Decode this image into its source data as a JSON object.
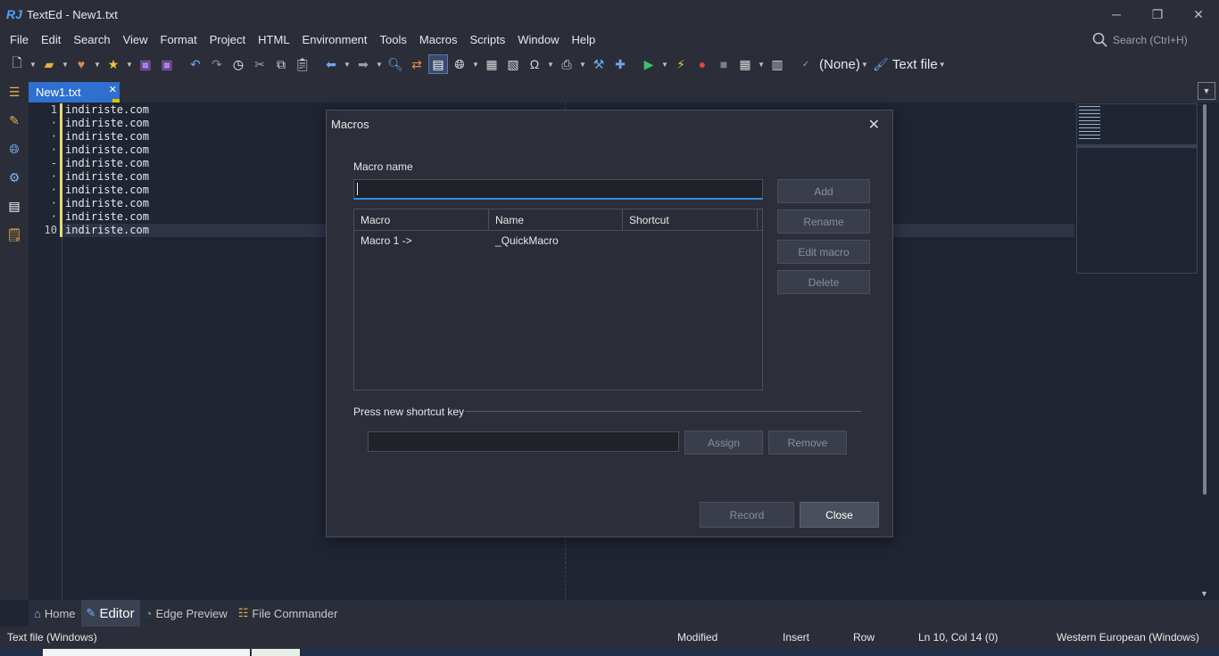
{
  "window": {
    "logo": "RJ",
    "title": "TextEd - New1.txt",
    "controls": [
      "─",
      "❐",
      "✕"
    ]
  },
  "menu": [
    "File",
    "Edit",
    "Search",
    "View",
    "Format",
    "Project",
    "HTML",
    "Environment",
    "Tools",
    "Macros",
    "Scripts",
    "Window",
    "Help"
  ],
  "search": {
    "placeholder": "Search (Ctrl+H)"
  },
  "toolbar": {
    "spell_mode": "(None)",
    "file_type": "Text file",
    "icons": [
      "new-file-icon",
      "open-folder-icon",
      "favorites-icon",
      "star-icon",
      "save-icon",
      "save-all-icon",
      "undo-icon",
      "redo-icon",
      "history-icon",
      "cut-icon",
      "copy-icon",
      "paste-icon",
      "back-icon",
      "forward-icon",
      "find-icon",
      "replace-icon",
      "browser-preview-icon",
      "globe-icon",
      "html-tag-icon",
      "html-image-icon",
      "omega-icon",
      "print-icon",
      "tools-icon",
      "plugin-icon",
      "run-icon",
      "lightning-icon",
      "record-icon",
      "stop-icon",
      "grid-icon",
      "layout-icon",
      "spellcheck-icon",
      "brush-icon"
    ]
  },
  "tab": {
    "label": "New1.txt",
    "close": "✕"
  },
  "editor": {
    "line_numbers": [
      "1",
      "·",
      "·",
      "·",
      "-",
      "·",
      "·",
      "·",
      "·",
      "10"
    ],
    "lines": [
      "indiriste.com",
      "indiriste.com",
      "indiriste.com",
      "indiriste.com",
      "indiriste.com",
      "indiriste.com",
      "indiriste.com",
      "indiriste.com",
      "indiriste.com",
      "indiriste.com"
    ]
  },
  "bottom_tabs": [
    {
      "label": "Home",
      "icon": "home-icon"
    },
    {
      "label": "Editor",
      "icon": "edit-icon"
    },
    {
      "label": "Edge Preview",
      "icon": "edge-icon"
    },
    {
      "label": "File Commander",
      "icon": "file-commander-icon"
    }
  ],
  "status": {
    "file_type": "Text file (Windows)",
    "state": "Modified",
    "mode": "Insert",
    "selection": "Row",
    "position": "Ln 10, Col 14 (0)",
    "encoding": "Western European (Windows)"
  },
  "dialog": {
    "title": "Macros",
    "close": "✕",
    "macro_name_label": "Macro name",
    "macro_name_value": "",
    "buttons": {
      "add": "Add",
      "rename": "Rename",
      "edit": "Edit macro",
      "delete": "Delete"
    },
    "columns": [
      "Macro",
      "Name",
      "Shortcut"
    ],
    "rows": [
      {
        "macro": "Macro  1 ->",
        "name": "_QuickMacro",
        "shortcut": ""
      }
    ],
    "shortcut_label": "Press new shortcut key",
    "shortcut_value": "",
    "assign": "Assign",
    "remove": "Remove",
    "record": "Record",
    "close_button": "Close"
  }
}
